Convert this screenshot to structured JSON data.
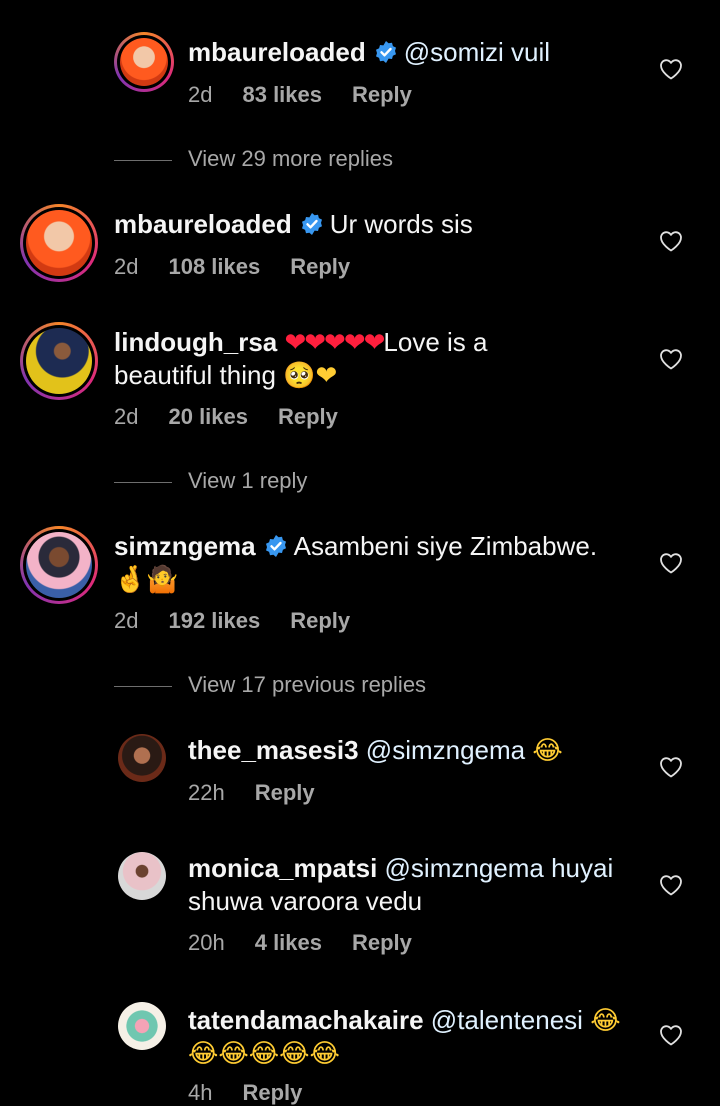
{
  "comments": [
    {
      "username": "mbaureloaded",
      "text": "@somizi vuil",
      "time": "2d",
      "likes": "83 likes",
      "reply": "Reply",
      "verified": true
    },
    {
      "username": "mbaureloaded",
      "text": "Ur words sis",
      "time": "2d",
      "likes": "108 likes",
      "reply": "Reply",
      "verified": true
    },
    {
      "username": "lindough_rsa",
      "text_emoji": "❤❤❤❤❤",
      "text": "Love is a",
      "text_line2": "beautiful thing",
      "text_line2_emoji": "🥺❤",
      "time": "2d",
      "likes": "20 likes",
      "reply": "Reply"
    },
    {
      "username": "simzngema",
      "text": "Asambeni siye Zimbabwe.",
      "text_line2_emoji": "🤞🤷",
      "time": "2d",
      "likes": "192 likes",
      "reply": "Reply",
      "verified": true
    },
    {
      "username": "thee_masesi3",
      "text": "@simzngema",
      "text_emoji": "😂",
      "time": "22h",
      "reply": "Reply"
    },
    {
      "username": "monica_mpatsi",
      "text": "@simzngema huyai",
      "text_line2": "shuwa varoora vedu",
      "time": "20h",
      "likes": "4 likes",
      "reply": "Reply"
    },
    {
      "username": "tatendamachakaire",
      "text": "@talentenesi",
      "text_emoji": "😂",
      "text_line2_emoji": "😂😂😂😂😂",
      "time": "4h",
      "reply": "Reply"
    }
  ],
  "view_replies": [
    "View 29 more replies",
    "View 1 reply",
    "View 17 previous replies"
  ],
  "colors": {
    "background": "#000000",
    "text": "#f5f5f5",
    "meta": "#a8a8a8",
    "verified": "#3897f0",
    "heart_emoji": "#ff1f3d"
  }
}
